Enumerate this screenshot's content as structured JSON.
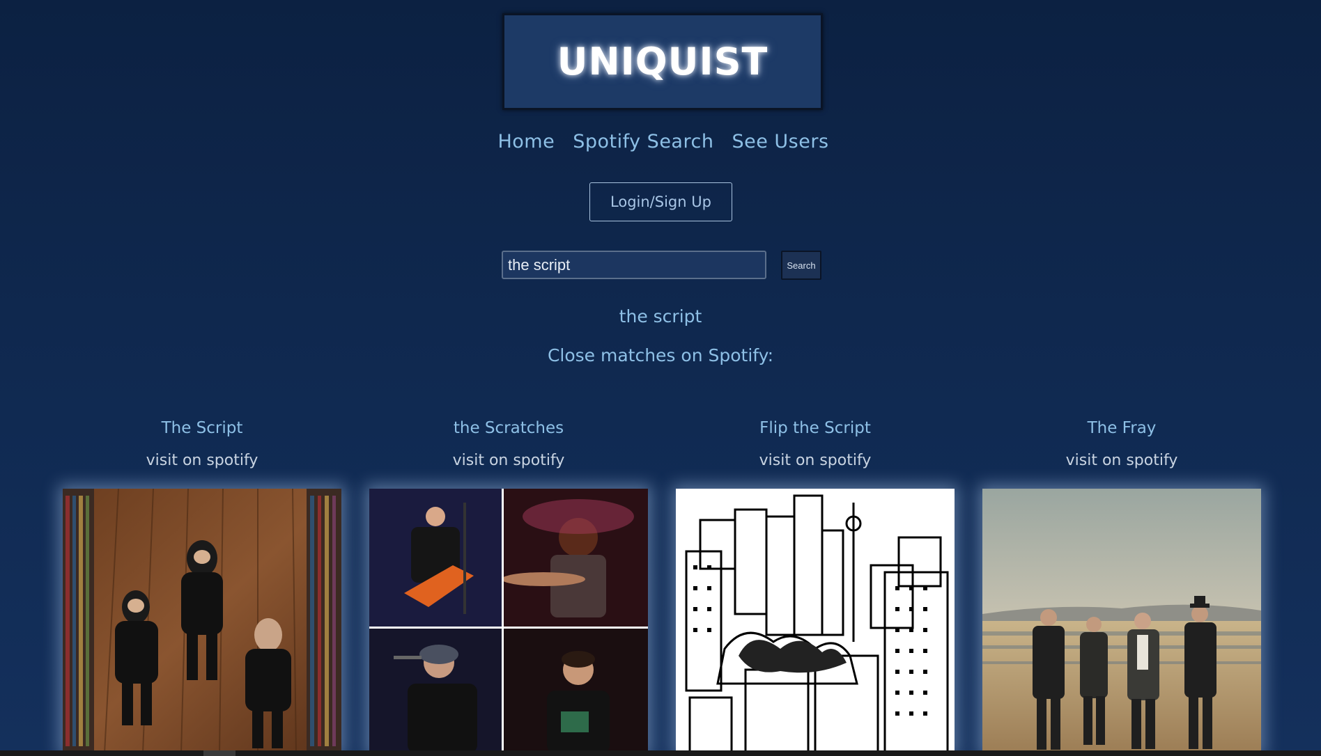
{
  "brand": {
    "logo_text": "UNIQUIST"
  },
  "nav": {
    "items": [
      {
        "label": "Home"
      },
      {
        "label": "Spotify Search"
      },
      {
        "label": "See Users"
      }
    ]
  },
  "auth": {
    "login_label": "Login/Sign Up"
  },
  "search": {
    "value": "the script",
    "button_label": "Search"
  },
  "results": {
    "query_echo": "the script",
    "heading": "Close matches on Spotify:",
    "artists": [
      {
        "name": "The Script",
        "link_label": "visit on spotify"
      },
      {
        "name": "the Scratches",
        "link_label": "visit on spotify"
      },
      {
        "name": "Flip the Script",
        "link_label": "visit on spotify"
      },
      {
        "name": "The Fray",
        "link_label": "visit on spotify"
      }
    ]
  },
  "colors": {
    "background": "#0c2142",
    "accent_text": "#8ec0e6",
    "logo_box": "#1d3a66"
  }
}
